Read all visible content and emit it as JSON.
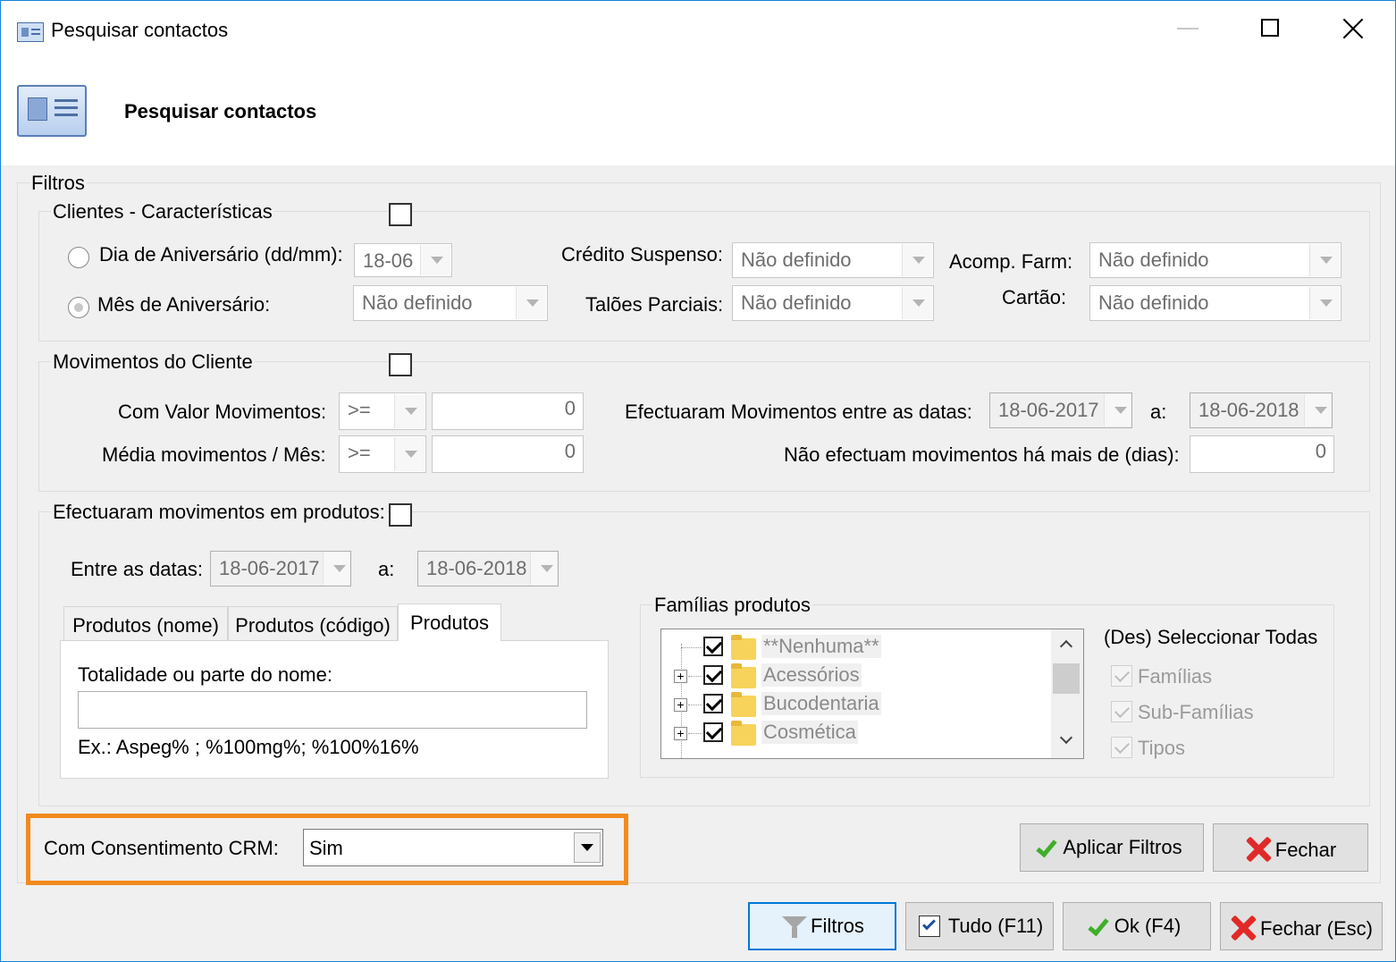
{
  "window": {
    "title": "Pesquisar contactos",
    "header_title": "Pesquisar contactos",
    "icon": "contact-card-icon",
    "controls": {
      "minimize": "minimize-icon",
      "maximize": "maximize-icon",
      "close": "close-icon"
    }
  },
  "filtros": {
    "legend": "Filtros",
    "clientes": {
      "legend": "Clientes - Características",
      "dia_aniversario_label": "Dia de Aniversário (dd/mm):",
      "dia_aniversario_value": "18-06",
      "mes_aniversario_label": "Mês de Aniversário:",
      "mes_aniversario_value": "Não definido",
      "credito_suspenso_label": "Crédito Suspenso:",
      "credito_suspenso_value": "Não definido",
      "taloes_parciais_label": "Talões Parciais:",
      "taloes_parciais_value": "Não definido",
      "acomp_farm_label": "Acomp. Farm:",
      "acomp_farm_value": "Não definido",
      "cartao_label": "Cartão:",
      "cartao_value": "Não definido"
    },
    "movimentos": {
      "legend": "Movimentos do Cliente",
      "com_valor_label": "Com Valor Movimentos:",
      "com_valor_op": ">=",
      "com_valor_value": "0",
      "media_label": "Média movimentos / Mês:",
      "media_op": ">=",
      "media_value": "0",
      "entre_datas_label": "Efectuaram Movimentos entre as datas:",
      "data_inicio": "18-06-2017",
      "a_label": "a:",
      "data_fim": "18-06-2018",
      "nao_efectuam_label": "Não efectuam movimentos há mais de (dias):",
      "nao_efectuam_value": "0"
    },
    "produtos": {
      "legend": "Efectuaram movimentos em produtos:",
      "entre_label": "Entre as datas:",
      "data_inicio": "18-06-2017",
      "a_label": "a:",
      "data_fim": "18-06-2018",
      "tabs": [
        "Produtos (nome)",
        "Produtos (código)",
        "Produtos"
      ],
      "totalidade_label": "Totalidade ou parte do nome:",
      "totalidade_value": "",
      "exemplo": "Ex.: Aspeg% ; %100mg%; %100%16%",
      "familias_legend": "Famílias produtos",
      "familias": [
        "**Nenhuma**",
        "Acessórios",
        "Bucodentaria",
        "Cosmética"
      ],
      "des_seleccionar": "(Des) Seleccionar Todas",
      "opt_familias": "Famílias",
      "opt_subfamilias": "Sub-Famílias",
      "opt_tipos": "Tipos"
    },
    "crm": {
      "label": "Com Consentimento CRM:",
      "value": "Sim",
      "highlight_color": "#f28a1e"
    },
    "aplicar_label": "Aplicar Filtros",
    "fechar_label": "Fechar"
  },
  "footer": {
    "filtros_label": "Filtros",
    "tudo_label": "Tudo (F11)",
    "ok_label": "Ok (F4)",
    "fechar_label": "Fechar (Esc)"
  }
}
